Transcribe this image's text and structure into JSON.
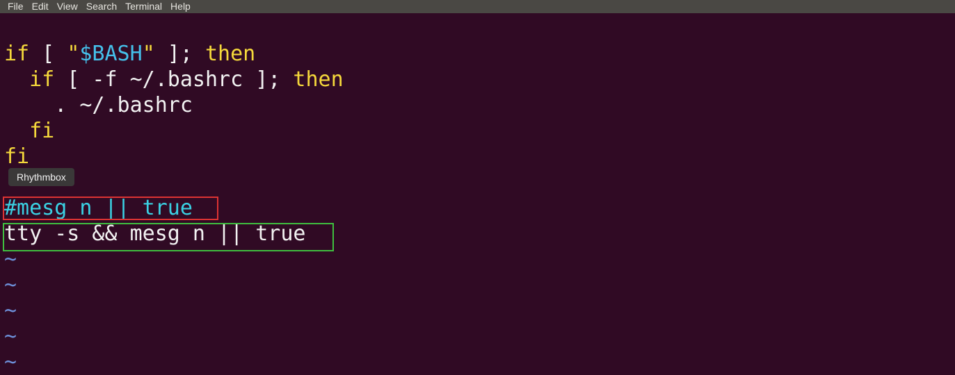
{
  "menubar": {
    "items": [
      "File",
      "Edit",
      "View",
      "Search",
      "Terminal",
      "Help"
    ]
  },
  "editor": {
    "line1": {
      "kw1": "if",
      "p1": " [ ",
      "q1": "\"",
      "var": "$BASH",
      "q2": "\"",
      "p2": " ]; ",
      "kw2": "then"
    },
    "line2": {
      "indent": "  ",
      "kw1": "if",
      "p1": " [ -f ~/.bashrc ]; ",
      "kw2": "then"
    },
    "line3": {
      "text": "    . ~/.bashrc"
    },
    "line4": {
      "indent": "  ",
      "kw": "fi"
    },
    "line5": {
      "kw": "fi"
    },
    "line7": {
      "text": "#mesg n || true"
    },
    "line8": {
      "text": "tty -s && mesg n || true"
    },
    "tilde": "~"
  },
  "tooltip": {
    "label": "Rhythmbox"
  },
  "colors": {
    "background": "#300a24",
    "keyword": "#f5d83b",
    "variable": "#45c0ea",
    "comment": "#3ad1e3",
    "highlight_red": "#dd3333",
    "highlight_green": "#3fbf3f"
  }
}
